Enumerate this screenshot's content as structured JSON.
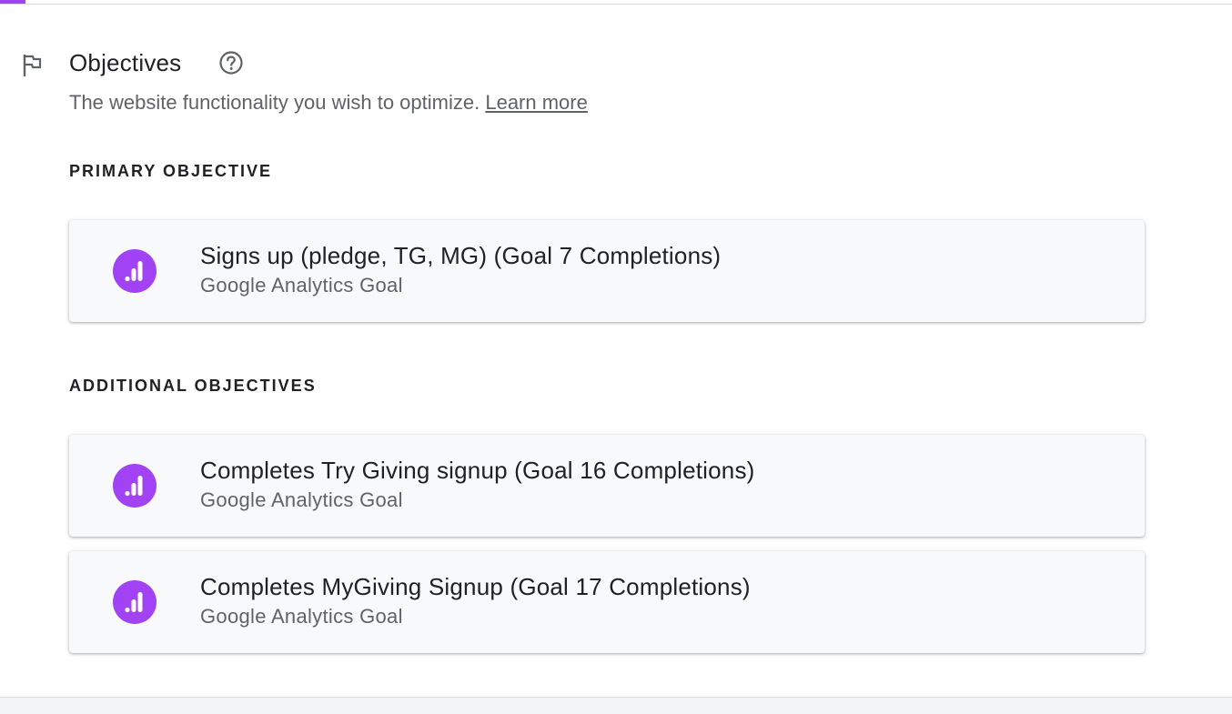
{
  "colors": {
    "accent": "#a142f4",
    "ga_icon": "#a142f4",
    "text_primary": "#202124",
    "text_secondary": "#5f6368",
    "card_bg": "#f8f9fa"
  },
  "section": {
    "icon": "flag-icon",
    "title": "Objectives",
    "help_icon": "help-circle-icon",
    "description": "The website functionality you wish to optimize.",
    "learn_more": "Learn more"
  },
  "primary": {
    "label": "PRIMARY OBJECTIVE",
    "objectives": [
      {
        "icon": "google-analytics-icon",
        "name": "Signs up (pledge, TG, MG) (Goal 7 Completions)",
        "type": "Google Analytics Goal"
      }
    ]
  },
  "additional": {
    "label": "ADDITIONAL OBJECTIVES",
    "objectives": [
      {
        "icon": "google-analytics-icon",
        "name": "Completes Try Giving signup (Goal 16 Completions)",
        "type": "Google Analytics Goal"
      },
      {
        "icon": "google-analytics-icon",
        "name": "Completes MyGiving Signup (Goal 17 Completions)",
        "type": "Google Analytics Goal"
      }
    ]
  }
}
